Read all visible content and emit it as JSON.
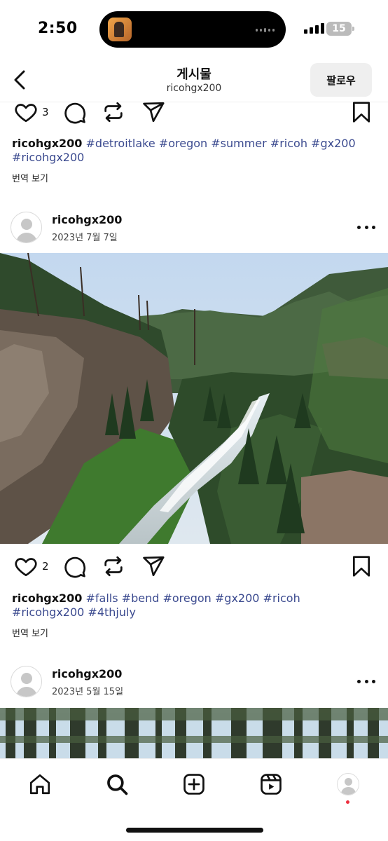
{
  "status_bar": {
    "time": "2:50",
    "battery": "15"
  },
  "header": {
    "title": "게시물",
    "subtitle": "ricohgx200",
    "follow_label": "팔로우"
  },
  "posts": [
    {
      "likes": "3",
      "username": "ricohgx200",
      "tags": "#detroitlake #oregon #summer #ricoh #gx200 #ricohgx200",
      "translate": "번역 보기"
    },
    {
      "username": "ricohgx200",
      "date": "2023년 7월 7일",
      "photo_icon": "river-canyon-photo",
      "likes": "2",
      "caption_user": "ricohgx200",
      "tags": "#falls #bend #oregon #gx200 #ricoh #ricohgx200 #4thjuly",
      "translate": "번역 보기"
    },
    {
      "username": "ricohgx200",
      "date": "2023년 5월 15일",
      "photo_icon": "forest-photo"
    }
  ],
  "bottom_nav": [
    "home-icon",
    "search-icon",
    "create-icon",
    "reels-icon",
    "profile-icon"
  ],
  "colors": {
    "hashtag": "#3b4a8f",
    "notification_dot": "#ed2e3e",
    "follow_bg": "#efefef"
  }
}
